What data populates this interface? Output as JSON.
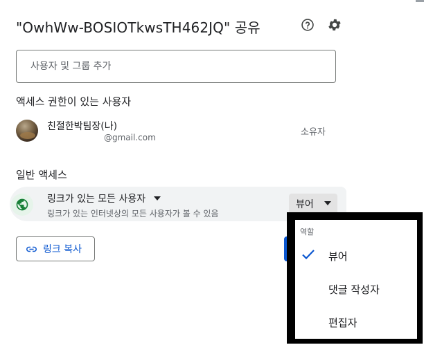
{
  "dialog": {
    "title": "\"OwhWw-BOSIOTkwsTH462JQ\" 공유",
    "help_icon": "help-circle-icon",
    "settings_icon": "gear-icon"
  },
  "add_people": {
    "placeholder": "사용자 및 그룹 추가"
  },
  "people_with_access": {
    "title": "액세스 권한이 있는 사용자",
    "users": [
      {
        "name": "친절한박팀장(나)",
        "email": "@gmail.com",
        "role": "소유자"
      }
    ]
  },
  "general_access": {
    "title": "일반 액세스",
    "icon": "globe-icon",
    "selector_label": "링크가 있는 모든 사용자",
    "description": "링크가 있는 인터넷상의 모든 사용자가 볼 수 있음",
    "role": "뷰어"
  },
  "copy_link": {
    "label": "링크 복사",
    "icon": "link-icon"
  },
  "role_menu": {
    "header": "역할",
    "items": [
      {
        "label": "뷰어",
        "selected": true
      },
      {
        "label": "댓글 작성자",
        "selected": false
      },
      {
        "label": "편집자",
        "selected": false
      }
    ]
  },
  "colors": {
    "accent_blue": "#0b57d0",
    "globe_green": "#188038",
    "menu_border": "#000000"
  }
}
